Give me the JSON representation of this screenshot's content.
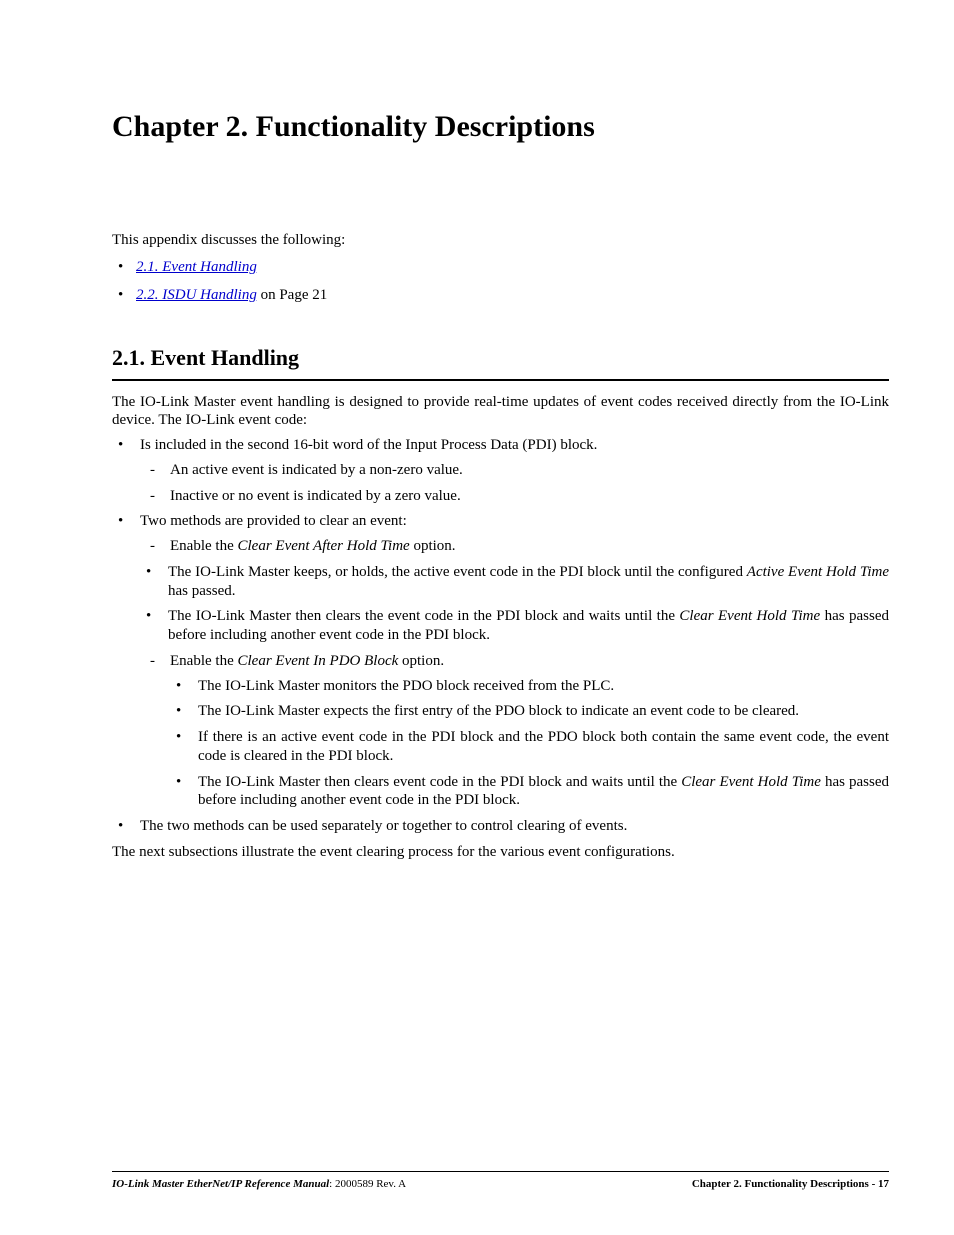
{
  "chapter": {
    "title": "Chapter 2.  Functionality Descriptions"
  },
  "intro": {
    "lead": "This appendix discusses the following:",
    "links": {
      "event": "2.1. Event Handling",
      "isdu": "2.2. ISDU Handling",
      "isdu_suffix": " on Page 21"
    }
  },
  "section": {
    "heading": "2.1. Event Handling",
    "p1": "The IO-Link Master event handling is designed to provide real-time updates of event codes received directly from the IO-Link device. The IO-Link event code:",
    "b1": "Is included in the second 16-bit word of the Input Process Data (PDI) block.",
    "b1d1": "An active event is indicated by a non-zero value.",
    "b1d2": "Inactive or no event is indicated by a zero value.",
    "b2": "Two methods are provided to clear an event:",
    "b2d1_pre": "Enable the ",
    "b2d1_em": "Clear Event After Hold Time",
    "b2d1_post": " option.",
    "b2s1_pre": "The IO-Link Master keeps, or holds, the active event code in the PDI block until the configured ",
    "b2s1_em": "Active Event Hold Time",
    "b2s1_post": " has passed.",
    "b2s2_pre": "The IO-Link Master then clears the event code in the PDI block and waits until the ",
    "b2s2_em": "Clear Event Hold Time",
    "b2s2_post": " has passed before including another event code in the PDI block.",
    "b2d2_pre": "Enable the ",
    "b2d2_em": "Clear Event In PDO Block",
    "b2d2_post": " option.",
    "b2d2s1": "The IO-Link Master monitors the PDO block received from the PLC.",
    "b2d2s2": "The IO-Link Master expects the first entry of the PDO block to indicate an event code to be cleared.",
    "b2d2s3": "If there is an active event code in the PDI block and the PDO block both contain the same event code, the event code is cleared in the PDI block.",
    "b2d2s4_pre": "The IO-Link Master then clears event code in the PDI block and waits until the ",
    "b2d2s4_em": "Clear Event Hold Time",
    "b2d2s4_post": " has passed before including another event code in the PDI block.",
    "b3": "The two methods can be used separately or together to control clearing of events.",
    "p2": "The next subsections illustrate the event clearing process for the various event configurations."
  },
  "footer": {
    "manual": "IO-Link Master EtherNet/IP Reference Manual",
    "rev": ": 2000589 Rev. A",
    "right": "Chapter 2. Functionality Descriptions  - 17"
  }
}
